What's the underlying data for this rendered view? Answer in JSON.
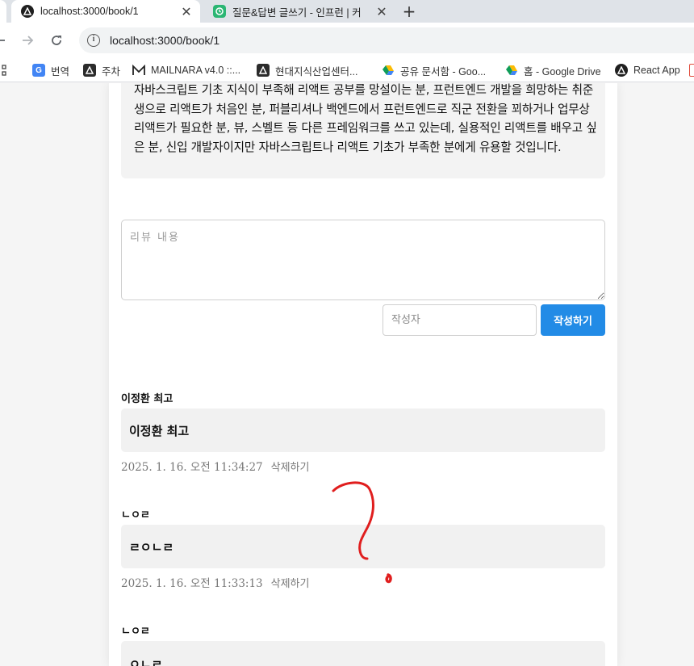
{
  "browser": {
    "tabs": [
      {
        "title": "localhost:3000/book/1",
        "active": true,
        "icon": "react-router-icon"
      },
      {
        "title": "질문&답변 글쓰기 - 인프런 | 커",
        "active": false,
        "icon": "inflearn-icon"
      }
    ],
    "url": "localhost:3000/book/1",
    "bookmarks": [
      {
        "label": "번역",
        "icon": "google-translate-icon"
      },
      {
        "label": "주차",
        "icon": "triangle-logo-icon"
      },
      {
        "label": "MAILNARA v4.0 ::...",
        "icon": "mailnara-icon"
      },
      {
        "label": "현대지식산업센터...",
        "icon": "triangle-logo-icon"
      },
      {
        "label": "공유 문서함 - Goo...",
        "icon": "google-drive-icon"
      },
      {
        "label": "홈 - Google Drive",
        "icon": "google-drive-icon"
      },
      {
        "label": "React App",
        "icon": "react-router-icon"
      }
    ],
    "colors": {
      "tabstrip": "#dfe3e8",
      "omnibox": "#f1f3f4"
    }
  },
  "book": {
    "description": "자바스크립트 기초 지식이 부족해 리액트 공부를 망설이는 분, 프런트엔드 개발을 희망하는 취준생으로 리액트가 처음인 분, 퍼블리셔나 백엔드에서 프런트엔드로 직군 전환을 꾀하거나 업무상 리액트가 필요한 분, 뷰, 스벨트 등 다른 프레임워크를 쓰고 있는데, 실용적인 리액트를 배우고 싶은 분, 신입 개발자이지만 자바스크립트나 리액트 기초가 부족한 분에게 유용할 것입니다."
  },
  "review_form": {
    "content_placeholder": "리뷰 내용",
    "content_value": "",
    "author_placeholder": "작성자",
    "author_value": "",
    "submit_label": "작성하기",
    "accent_color": "#228be6"
  },
  "reviews": [
    {
      "author": "이정환 최고",
      "content": "이정환 최고",
      "date": "2025. 1. 16. 오전 11:34:27",
      "delete_label": "삭제하기"
    },
    {
      "author": "ㄴㅇㄹ",
      "content": "ㄹㅇㄴㄹ",
      "date": "2025. 1. 16. 오전 11:33:13",
      "delete_label": "삭제하기"
    },
    {
      "author": "ㄴㅇㄹ",
      "content": "ㅇㄴㄹ",
      "date": "",
      "delete_label": ""
    }
  ],
  "annotation": {
    "symbol": "question-mark-scribble",
    "color": "#e01e1e"
  }
}
